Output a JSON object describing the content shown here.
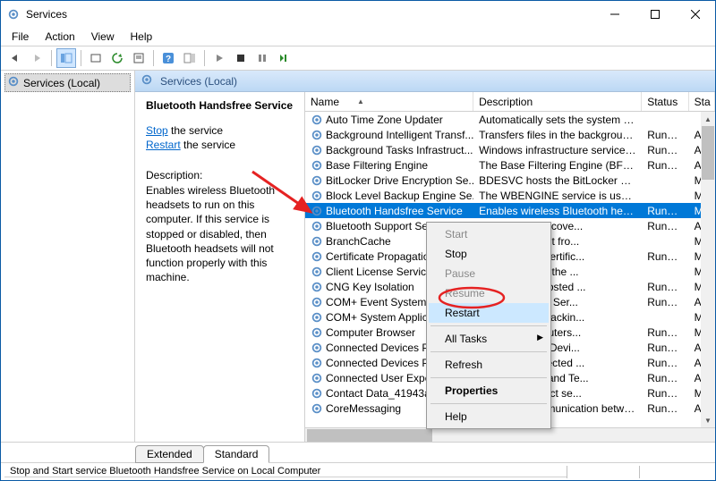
{
  "title": "Services",
  "menubar": [
    "File",
    "Action",
    "View",
    "Help"
  ],
  "tree": {
    "root": "Services (Local)"
  },
  "pane_header": "Services (Local)",
  "description": {
    "title": "Bluetooth Handsfree Service",
    "stop": "Stop",
    "restart": "Restart",
    "the_service": " the service",
    "label": "Description:",
    "body": "Enables wireless Bluetooth headsets to run on this computer. If this service is stopped or disabled, then Bluetooth headsets will not function properly with this machine."
  },
  "columns": {
    "name": "Name",
    "desc": "Description",
    "status": "Status",
    "start": "Sta"
  },
  "rows": [
    {
      "n": "Auto Time Zone Updater",
      "d": "Automatically sets the system time zone.",
      "s": "",
      "t": ""
    },
    {
      "n": "Background Intelligent Transf...",
      "d": "Transfers files in the background using i...",
      "s": "Running",
      "t": "Au"
    },
    {
      "n": "Background Tasks Infrastruct...",
      "d": "Windows infrastructure service that con...",
      "s": "Running",
      "t": "Au"
    },
    {
      "n": "Base Filtering Engine",
      "d": "The Base Filtering Engine (BFE) is a servi...",
      "s": "Running",
      "t": "Au"
    },
    {
      "n": "BitLocker Drive Encryption Se...",
      "d": "BDESVC hosts the BitLocker Drive Encry...",
      "s": "",
      "t": "Mi"
    },
    {
      "n": "Block Level Backup Engine Se...",
      "d": "The WBENGINE service is used by Wind...",
      "s": "",
      "t": "Mi"
    },
    {
      "n": "Bluetooth Handsfree Service",
      "d": "Enables wireless Bluetooth headsets to r...",
      "s": "Running",
      "t": "Mi",
      "sel": true
    },
    {
      "n": "Bluetooth Support Servic",
      "d": "ce supports discove...",
      "s": "Running",
      "t": "Au"
    },
    {
      "n": "BranchCache",
      "d": "network content fro...",
      "s": "",
      "t": "Mi"
    },
    {
      "n": "Certificate Propagation",
      "d": "ates and root certific...",
      "s": "Running",
      "t": "Mi"
    },
    {
      "n": "Client License Service (C",
      "d": "ure support for the ...",
      "s": "",
      "t": "Mi"
    },
    {
      "n": "CNG Key Isolation",
      "d": "on service is hosted ...",
      "s": "Running",
      "t": "Mi"
    },
    {
      "n": "COM+ Event System",
      "d": "ent Notification Ser...",
      "s": "Running",
      "t": "Au"
    },
    {
      "n": "COM+ System Applicati",
      "d": "iguration and trackin...",
      "s": "",
      "t": "Mi"
    },
    {
      "n": "Computer Browser",
      "d": "ed list of computers...",
      "s": "Running",
      "t": "Mi"
    },
    {
      "n": "Connected Devices Platf",
      "d": "for Connected Devi...",
      "s": "Running",
      "t": "Au"
    },
    {
      "n": "Connected Devices Platf",
      "d": "used for Connected ...",
      "s": "Running",
      "t": "Au"
    },
    {
      "n": "Connected User Experien",
      "d": "r Experiences and Te...",
      "s": "Running",
      "t": "Au"
    },
    {
      "n": "Contact Data_41943a5",
      "d": "a for fast contact se...",
      "s": "Running",
      "t": "Mi"
    },
    {
      "n": "CoreMessaging",
      "d": "Manages communication between syst...",
      "s": "Running",
      "t": "Au"
    }
  ],
  "tabs": {
    "extended": "Extended",
    "standard": "Standard"
  },
  "statusbar": "Stop and Start service Bluetooth Handsfree Service on Local Computer",
  "context": {
    "start": "Start",
    "stop": "Stop",
    "pause": "Pause",
    "resume": "Resume",
    "restart": "Restart",
    "all_tasks": "All Tasks",
    "refresh": "Refresh",
    "properties": "Properties",
    "help": "Help"
  }
}
